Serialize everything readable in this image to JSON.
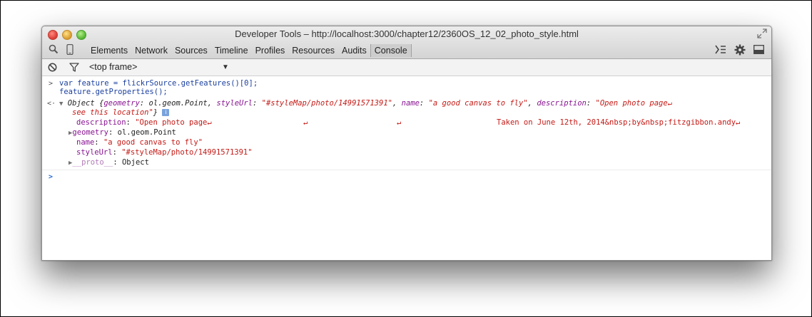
{
  "window": {
    "title": "Developer Tools – http://localhost:3000/chapter12/2360OS_12_02_photo_style.html"
  },
  "toolbar": {
    "tabs": [
      {
        "label": "Elements"
      },
      {
        "label": "Network"
      },
      {
        "label": "Sources"
      },
      {
        "label": "Timeline"
      },
      {
        "label": "Profiles"
      },
      {
        "label": "Resources"
      },
      {
        "label": "Audits"
      },
      {
        "label": "Console",
        "active": true
      }
    ],
    "left_icons": [
      "search-icon",
      "device-icon"
    ],
    "right_icons": [
      "drawer-icon",
      "gear-icon",
      "dock-icon"
    ]
  },
  "console_bar": {
    "frame_select": "<top frame>",
    "icons": [
      "clear-icon",
      "filter-icon"
    ]
  },
  "console": {
    "input_line1": "var feature = flickrSource.getFeatures()[0];",
    "input_line2": "feature.getProperties();",
    "summary": {
      "prefix": "Object {",
      "k_geometry": "geometry",
      "v_geometry": " ol.geom.Point",
      "k_styleUrl": "styleUrl",
      "v_styleUrl": "\"#styleMap/photo/14991571391\"",
      "k_name": "name",
      "v_name": "\"a good canvas to fly\"",
      "k_description": "description",
      "v_description": "\"Open photo page",
      "cont": "see this location\"",
      "suffix": "}"
    },
    "props": {
      "description_key": "description",
      "description_val": "\"Open photo page",
      "description_tail": "Taken on June 12th, 2014&nbsp;by&nbsp;fitzgibbon.andy",
      "geometry_key": "geometry",
      "geometry_val": "ol.geom.Point",
      "name_key": "name",
      "name_val": "\"a good canvas to fly\"",
      "styleUrl_key": "styleUrl",
      "styleUrl_val": "\"#styleMap/photo/14991571391\"",
      "proto_key": "__proto__",
      "proto_val": "Object"
    },
    "newline_glyph": "↵",
    "colors": {
      "input": "#1a3f9e",
      "string": "#c41a16",
      "key": "#881391"
    }
  }
}
